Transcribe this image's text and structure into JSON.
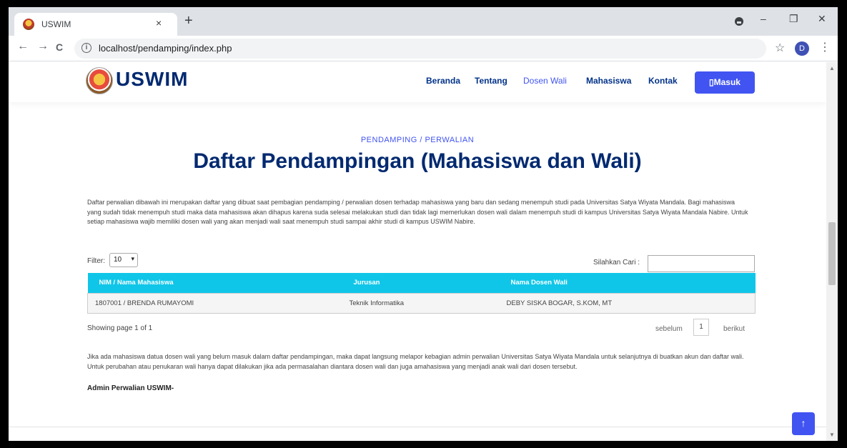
{
  "browser": {
    "tab_title": "USWIM",
    "tab_close": "×",
    "new_tab": "+",
    "url": "localhost/pendamping/index.php",
    "profile_initial": "D",
    "back": "←",
    "forward": "→",
    "reload": "C",
    "bookmark": "☆",
    "menu": "⋮",
    "minimize": "–",
    "restore": "❐",
    "close": "✕"
  },
  "site": {
    "logo_text": "USWIM",
    "nav": [
      "Beranda",
      "Tentang",
      "Dosen Wali",
      "Mahasiswa",
      "Kontak"
    ],
    "login_label": "▯Masuk"
  },
  "section": {
    "label": "PENDAMPING / PERWALIAN",
    "title": "Daftar Pendampingan (Mahasiswa dan Wali)",
    "intro": "Daftar perwalian dibawah ini merupakan daftar yang dibuat saat pembagian pendamping / perwalian dosen terhadap mahasiswa yang baru dan sedang menempuh studi pada Universitas Satya Wiyata Mandala. Bagi mahasiswa yang sudah tidak menempuh studi maka data mahasiswa akan dihapus karena suda selesai melakukan studi dan tidak lagi memerlukan dosen wali dalam menempuh studi di kampus Universitas Satya Wiyata Mandala Nabire. Untuk setiap mahasiswa wajib memiliki dosen wali yang akan menjadi wali saat menempuh studi sampai akhir studi di kampus USWIM Nabire."
  },
  "table_controls": {
    "filter_label": "Filter:",
    "filter_value": "10",
    "search_label": "Silahkan Cari :",
    "search_value": ""
  },
  "table": {
    "headers": [
      "NIM / Nama Mahasiswa",
      "Jurusan",
      "Nama Dosen Wali"
    ],
    "rows": [
      [
        "1807001 / BRENDA RUMAYOMI",
        "Teknik Informatika",
        "DEBY SISKA BOGAR, S.KOM, MT"
      ]
    ]
  },
  "pagination": {
    "showing": "Showing page 1 of 1",
    "prev": "sebelum",
    "page": "1",
    "next": "berikut"
  },
  "footer_note": {
    "text": "Jika ada mahasiswa datua dosen wali yang belum masuk dalam daftar pendampingan, maka dapat langsung melapor kebagian admin perwalian Universitas Satya Wiyata Mandala untuk selanjutnya di buatkan akun dan daftar wali. Untuk perubahan atau penukaran wali hanya dapat dilakukan jika ada permasalahan diantara dosen wali dan juga amahasiswa yang menjadi anak wali dari dosen tersebut.",
    "signoff": "Admin Perwalian USWIM-"
  },
  "back_to_top": "↑",
  "colors": {
    "brand_dark": "#012970",
    "accent": "#4154f1",
    "table_header": "#10c6e8"
  }
}
